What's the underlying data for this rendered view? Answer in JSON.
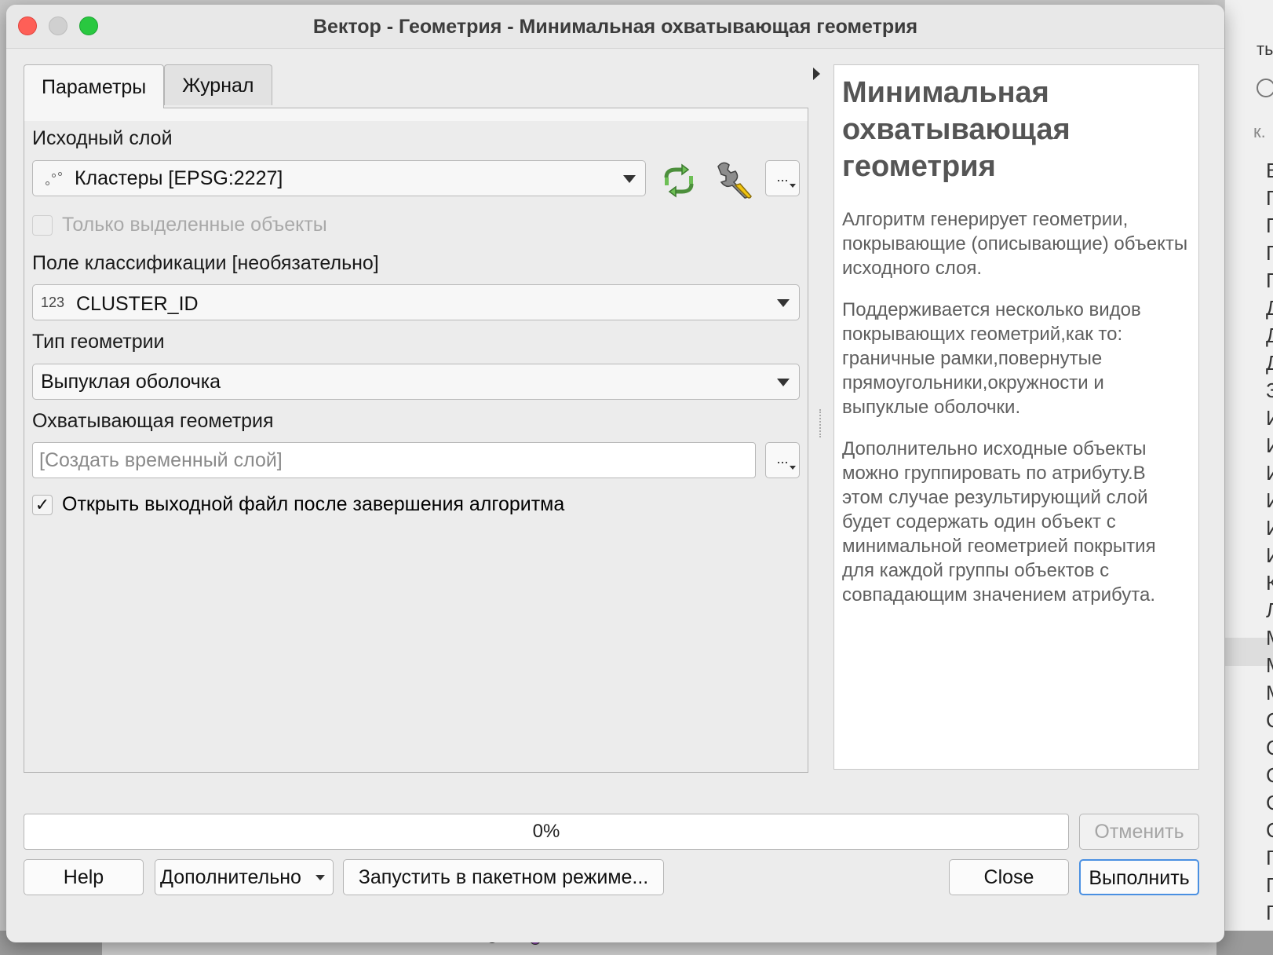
{
  "window": {
    "title": "Вектор - Геометрия - Минимальная охватывающая геометрия"
  },
  "tabs": [
    {
      "label": "Параметры",
      "active": true
    },
    {
      "label": "Журнал",
      "active": false
    }
  ],
  "params": {
    "input_layer": {
      "label": "Исходный слой",
      "value": "Кластеры [EPSG:2227]",
      "icon": "point-layer-icon"
    },
    "selected_only": {
      "label": "Только выделенные объекты",
      "checked": false,
      "enabled": false
    },
    "field": {
      "label": "Поле классификации [необязательно]",
      "type_prefix": "123",
      "value": "CLUSTER_ID"
    },
    "geometry_type": {
      "label": "Тип геометрии",
      "value": "Выпуклая оболочка"
    },
    "output": {
      "label": "Охватывающая геометрия",
      "placeholder": "[Создать временный слой]"
    },
    "open_after": {
      "label": "Открыть выходной файл после завершения алгоритма",
      "checked": true,
      "mark": "✓"
    },
    "dots": "..."
  },
  "help": {
    "title": "Минимальная охватывающая геометрия",
    "paragraphs": [
      "Алгоритм генерирует геометрии, покрывающие (описывающие) объекты исходного слоя.",
      "Поддерживается несколько видов покрывающих геометрий,как то: граничные рамки,повернутые прямоугольники,окружности и выпуклые оболочки.",
      "Дополнительно исходные объекты можно группировать по атрибуту.В этом случае результирующий слой будет содержать один объект с минимальной геометрией покрытия для каждой группы объектов с совпадающим значением атрибута."
    ]
  },
  "progress": {
    "value": 0,
    "text": "0%"
  },
  "buttons": {
    "cancel": "Отменить",
    "help": "Help",
    "advanced": "Дополнительно",
    "batch": "Запустить в пакетном режиме...",
    "close": "Close",
    "run": "Выполнить"
  },
  "background": {
    "top_fragment": "ты",
    "search_fragment": "к.",
    "list_letters": [
      "В",
      "П",
      "П",
      "П",
      "П",
      "Д",
      "Д",
      "Д",
      "З",
      "И",
      "И",
      "И",
      "И",
      "И",
      "И",
      "К",
      "Л",
      "М",
      "М",
      "М",
      "С",
      "С",
      "С",
      "С",
      "С",
      "П",
      "П",
      "П"
    ]
  },
  "colors": {
    "accent": "#4a90e2",
    "close": "#fe5f57",
    "maximize": "#29c840"
  }
}
